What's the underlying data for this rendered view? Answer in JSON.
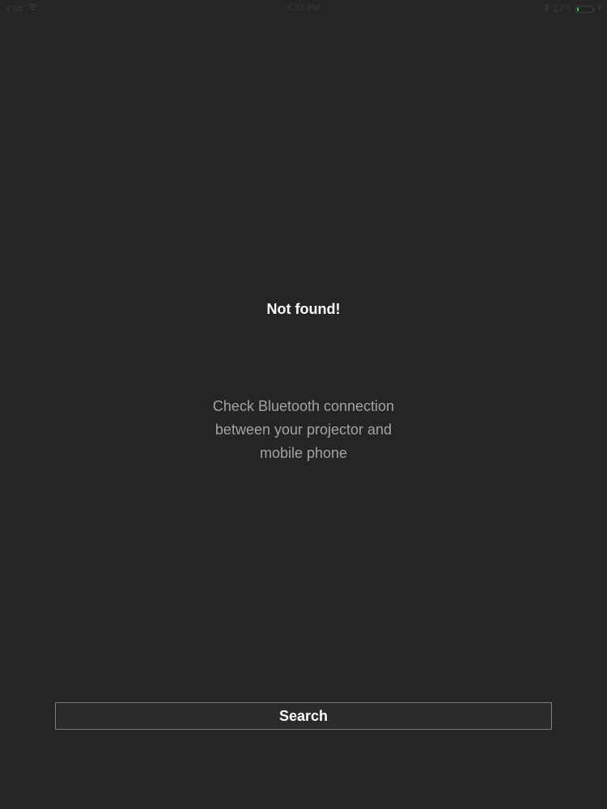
{
  "status_bar": {
    "device": "iPad",
    "time": "6:33 PM",
    "battery_percent": "12%",
    "battery_level": 0.12,
    "icons": [
      "wifi-icon",
      "bluetooth-icon",
      "battery-icon",
      "charging-icon"
    ]
  },
  "main": {
    "title": "Not found!",
    "message_lines": [
      "Check Bluetooth connection",
      "between your projector and",
      "mobile phone"
    ],
    "search_label": "Search"
  },
  "colors": {
    "background": "#252427",
    "title": "#ffffff",
    "message": "#a3a2a5",
    "button_border": "#7c7b7e",
    "battery_green": "#2fd44e"
  }
}
